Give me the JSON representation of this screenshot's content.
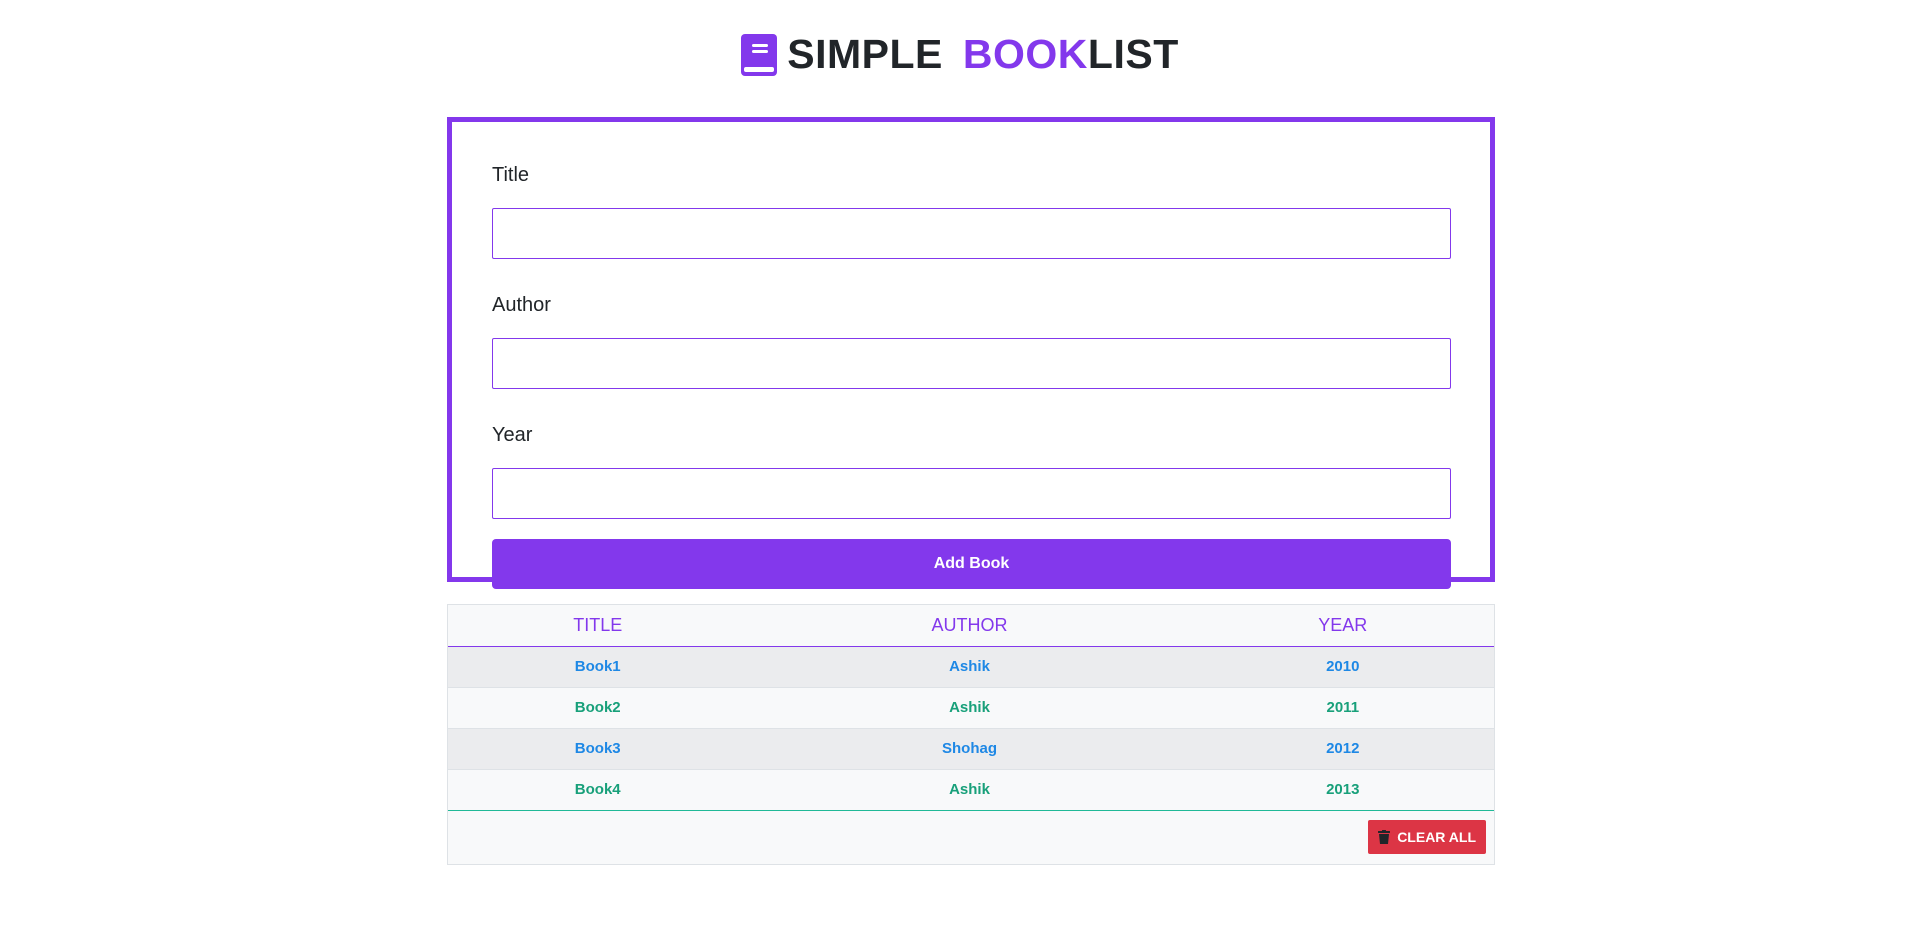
{
  "header": {
    "brand_simple": "SIMPLE",
    "brand_book": "BOOK",
    "brand_list": "LIST",
    "icon": "book-icon",
    "accent_color": "#8338ec"
  },
  "form": {
    "title_label": "Title",
    "title_value": "",
    "author_label": "Author",
    "author_value": "",
    "year_label": "Year",
    "year_value": "",
    "add_button": "Add Book"
  },
  "table": {
    "headers": [
      "TITLE",
      "AUTHOR",
      "YEAR"
    ],
    "rows": [
      {
        "title": "Book1",
        "author": "Ashik",
        "year": "2010"
      },
      {
        "title": "Book2",
        "author": "Ashik",
        "year": "2011"
      },
      {
        "title": "Book3",
        "author": "Shohag",
        "year": "2012"
      },
      {
        "title": "Book4",
        "author": "Ashik",
        "year": "2013"
      }
    ],
    "clear_button": "CLEAR ALL",
    "clear_icon": "trash-icon",
    "colors": {
      "odd_row_text": "#1e88e5",
      "even_row_text": "#18a07a",
      "danger": "#dc3545"
    }
  }
}
